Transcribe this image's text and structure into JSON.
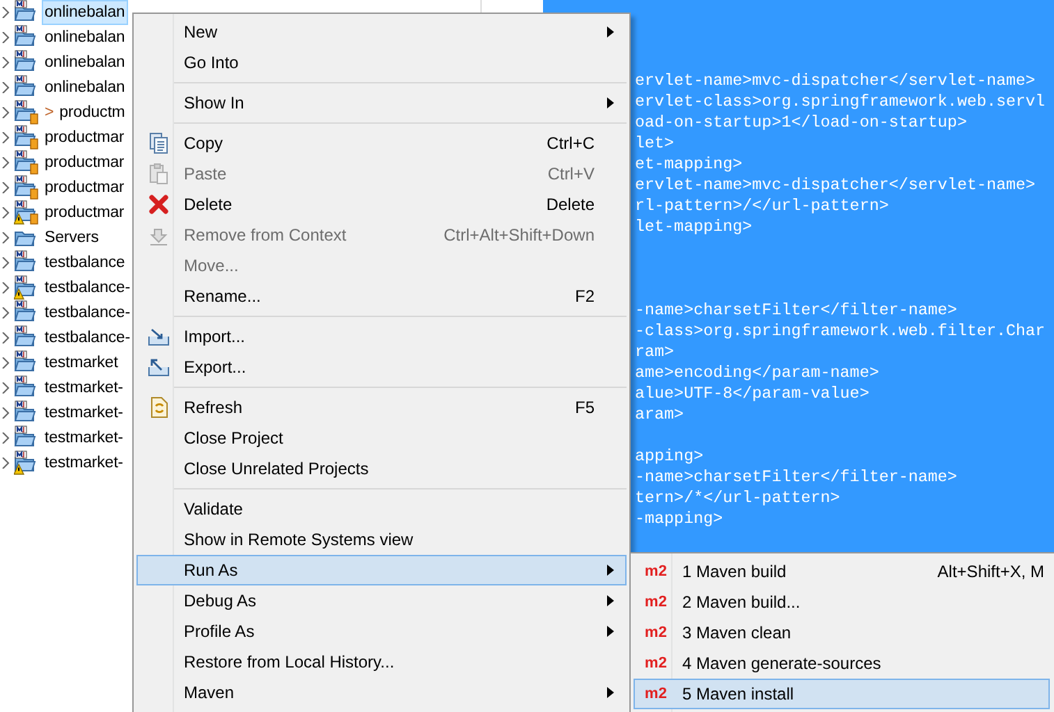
{
  "project_tree": {
    "items": [
      {
        "label": "onlinebalan",
        "kind": "maven",
        "selected": true,
        "expanded": false
      },
      {
        "label": "onlinebalan",
        "kind": "maven",
        "selected": false,
        "expanded": false
      },
      {
        "label": "onlinebalan",
        "kind": "maven",
        "selected": false,
        "expanded": false
      },
      {
        "label": "onlinebalan",
        "kind": "maven",
        "selected": false,
        "expanded": false
      },
      {
        "label": "productm",
        "prefix": ">",
        "kind": "maven-jar",
        "selected": false,
        "expanded": false
      },
      {
        "label": "productmar",
        "kind": "maven-jar",
        "selected": false,
        "expanded": false
      },
      {
        "label": "productmar",
        "kind": "maven-jar",
        "selected": false,
        "expanded": false
      },
      {
        "label": "productmar",
        "kind": "maven-jar",
        "selected": false,
        "expanded": false
      },
      {
        "label": "productmar",
        "kind": "maven-jar-warning",
        "selected": false,
        "expanded": false
      },
      {
        "label": "Servers",
        "kind": "folder",
        "selected": false,
        "expanded": false
      },
      {
        "label": "testbalance",
        "kind": "maven",
        "selected": false,
        "expanded": false
      },
      {
        "label": "testbalance-",
        "kind": "maven-warning",
        "selected": false,
        "expanded": false
      },
      {
        "label": "testbalance-",
        "kind": "maven",
        "selected": false,
        "expanded": false
      },
      {
        "label": "testbalance-",
        "kind": "maven",
        "selected": false,
        "expanded": false
      },
      {
        "label": "testmarket",
        "kind": "maven",
        "selected": false,
        "expanded": false
      },
      {
        "label": "testmarket-",
        "kind": "maven",
        "selected": false,
        "expanded": false
      },
      {
        "label": "testmarket-",
        "kind": "maven",
        "selected": false,
        "expanded": false
      },
      {
        "label": "testmarket-",
        "kind": "maven",
        "selected": false,
        "expanded": false
      },
      {
        "label": "testmarket-",
        "kind": "maven-warning",
        "selected": false,
        "expanded": false
      }
    ]
  },
  "editor": {
    "blocks": [
      {
        "lines": [
          "ervlet-name>mvc-dispatcher</servlet-name>",
          "ervlet-class>org.springframework.web.servl",
          "oad-on-startup>1</load-on-startup>",
          "let>",
          "et-mapping>",
          "ervlet-name>mvc-dispatcher</servlet-name>",
          "rl-pattern>/</url-pattern>",
          "let-mapping>"
        ]
      },
      {
        "lines": [
          "-name>charsetFilter</filter-name>",
          "-class>org.springframework.web.filter.Char",
          "ram>",
          "ame>encoding</param-name>",
          "alue>UTF-8</param-value>",
          "aram>"
        ]
      },
      {
        "lines": [
          "apping>",
          "-name>charsetFilter</filter-name>",
          "tern>/*</url-pattern>",
          "-mapping>"
        ]
      }
    ]
  },
  "context_menu": {
    "items": [
      {
        "kind": "item",
        "label": "New",
        "submenu": true,
        "disabled": false,
        "selected": false
      },
      {
        "kind": "item",
        "label": "Go Into",
        "submenu": false,
        "disabled": false,
        "selected": false
      },
      {
        "kind": "separator"
      },
      {
        "kind": "item",
        "label": "Show In",
        "submenu": true,
        "disabled": false,
        "selected": false
      },
      {
        "kind": "separator"
      },
      {
        "kind": "item",
        "label": "Copy",
        "shortcut": "Ctrl+C",
        "submenu": false,
        "disabled": false,
        "selected": false
      },
      {
        "kind": "item",
        "label": "Paste",
        "shortcut": "Ctrl+V",
        "submenu": false,
        "disabled": true,
        "selected": false
      },
      {
        "kind": "item",
        "label": "Delete",
        "shortcut": "Delete",
        "submenu": false,
        "disabled": false,
        "selected": false
      },
      {
        "kind": "item",
        "label": "Remove from Context",
        "shortcut": "Ctrl+Alt+Shift+Down",
        "submenu": false,
        "disabled": true,
        "selected": false
      },
      {
        "kind": "item",
        "label": "Move...",
        "submenu": false,
        "disabled": true,
        "selected": false
      },
      {
        "kind": "item",
        "label": "Rename...",
        "shortcut": "F2",
        "submenu": false,
        "disabled": false,
        "selected": false
      },
      {
        "kind": "separator"
      },
      {
        "kind": "item",
        "label": "Import...",
        "submenu": false,
        "disabled": false,
        "selected": false
      },
      {
        "kind": "item",
        "label": "Export...",
        "submenu": false,
        "disabled": false,
        "selected": false
      },
      {
        "kind": "separator"
      },
      {
        "kind": "item",
        "label": "Refresh",
        "shortcut": "F5",
        "submenu": false,
        "disabled": false,
        "selected": false
      },
      {
        "kind": "item",
        "label": "Close Project",
        "submenu": false,
        "disabled": false,
        "selected": false
      },
      {
        "kind": "item",
        "label": "Close Unrelated Projects",
        "submenu": false,
        "disabled": false,
        "selected": false
      },
      {
        "kind": "separator"
      },
      {
        "kind": "item",
        "label": "Validate",
        "submenu": false,
        "disabled": false,
        "selected": false
      },
      {
        "kind": "item",
        "label": "Show in Remote Systems view",
        "submenu": false,
        "disabled": false,
        "selected": false
      },
      {
        "kind": "item",
        "label": "Run As",
        "submenu": true,
        "disabled": false,
        "selected": true
      },
      {
        "kind": "item",
        "label": "Debug As",
        "submenu": true,
        "disabled": false,
        "selected": false
      },
      {
        "kind": "item",
        "label": "Profile As",
        "submenu": true,
        "disabled": false,
        "selected": false
      },
      {
        "kind": "item",
        "label": "Restore from Local History...",
        "submenu": false,
        "disabled": false,
        "selected": false
      },
      {
        "kind": "item",
        "label": "Maven",
        "submenu": true,
        "disabled": false,
        "selected": false
      }
    ]
  },
  "run_as_submenu": {
    "items": [
      {
        "badge": "m2",
        "label": "1 Maven build",
        "shortcut": "Alt+Shift+X, M",
        "selected": false
      },
      {
        "badge": "m2",
        "label": "2 Maven build...",
        "selected": false
      },
      {
        "badge": "m2",
        "label": "3 Maven clean",
        "selected": false
      },
      {
        "badge": "m2",
        "label": "4 Maven generate-sources",
        "selected": false
      },
      {
        "badge": "m2",
        "label": "5 Maven install",
        "selected": true
      }
    ]
  }
}
